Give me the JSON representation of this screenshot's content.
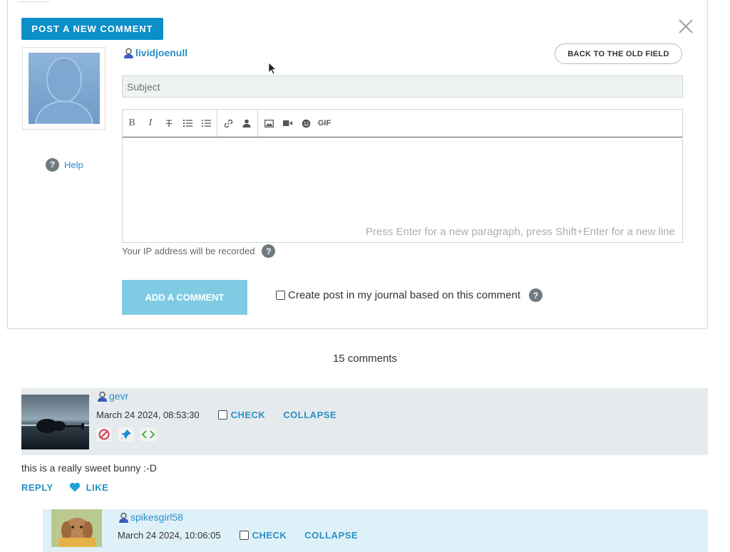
{
  "form": {
    "post_new_comment_label": "POST A NEW COMMENT",
    "username": "lividjoenull",
    "back_to_old_field_label": "BACK TO THE OLD FIELD",
    "subject_placeholder": "Subject",
    "help_label": "Help",
    "editor_hint": "Press Enter for a new paragraph, press Shift+Enter for a new line",
    "ip_note": "Your IP address will be recorded",
    "add_comment_label": "ADD A COMMENT",
    "journal_option_label": "Create post in my journal based on this comment",
    "toolbar": {
      "bold": "B",
      "italic": "I",
      "strikethrough": "T",
      "gif": "GIF"
    }
  },
  "comments_count": "15 comments",
  "comments": [
    {
      "username": "gevr",
      "date": "March 24 2024, 08:53:30",
      "check_label": "CHECK",
      "collapse_label": "COLLAPSE",
      "text": "this is a really sweet bunny :-D",
      "reply_label": "REPLY",
      "like_label": "LIKE"
    },
    {
      "username": "spikesgirl58",
      "date": "March 24 2024, 10:06:05",
      "check_label": "CHECK",
      "collapse_label": "COLLAPSE"
    }
  ],
  "colors": {
    "accent": "#0a8fc9",
    "link": "#2a8fc5",
    "add_button": "#80cbe4",
    "comment1_bg": "#e5eaec",
    "comment2_bg": "#dff1f8"
  }
}
